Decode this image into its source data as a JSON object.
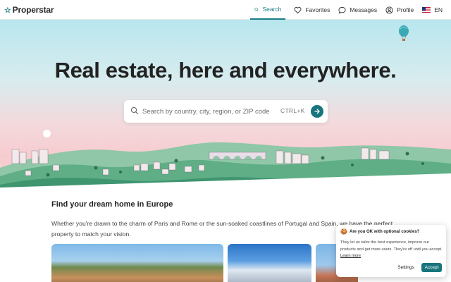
{
  "brand": {
    "name": "Properstar"
  },
  "nav": {
    "search": "Search",
    "favorites": "Favorites",
    "messages": "Messages",
    "profile": "Profile",
    "language": "EN"
  },
  "hero": {
    "title": "Real estate, here and everywhere.",
    "search_placeholder": "Search by country, city, region, or ZIP code",
    "shortcut": "CTRL+K"
  },
  "content": {
    "section_title": "Find your dream home in Europe",
    "intro": "Whether you're drawn to the charm of Paris and Rome or the sun-soaked coastlines of Portugal and Spain, we have the perfect property to match your vision."
  },
  "cookie": {
    "title": "Are you OK with optional cookies?",
    "body": "They let us tailor the best experience, improve our products and get more users. They're off until you accept.",
    "learn_more": "Learn more",
    "settings": "Settings",
    "accept": "Accept"
  },
  "colors": {
    "accent": "#18757d",
    "hero_top": "#b8e6ee",
    "hero_bottom": "#f6ccd0",
    "hills": "#4a9e74"
  }
}
